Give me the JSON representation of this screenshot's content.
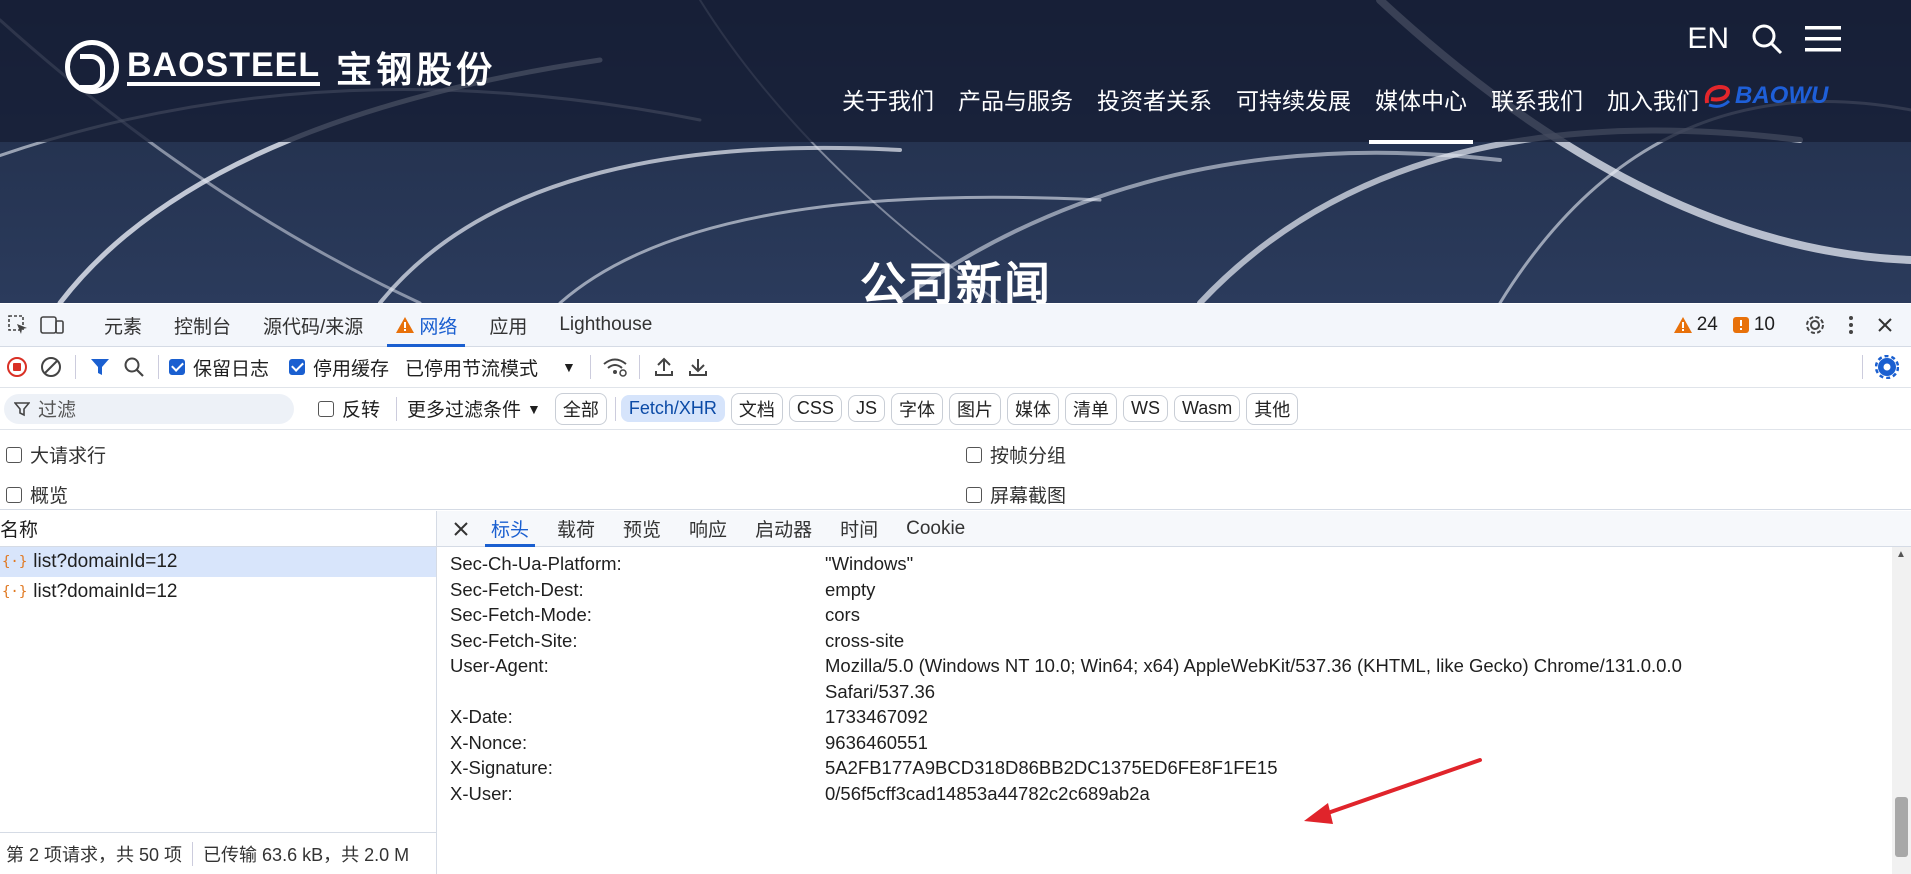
{
  "site": {
    "logo_en": "BAOSTEEL",
    "logo_cn": "宝钢股份",
    "lang": "EN",
    "nav": [
      "关于我们",
      "产品与服务",
      "投资者关系",
      "可持续发展",
      "媒体中心",
      "联系我们",
      "加入我们"
    ],
    "active_nav": "媒体中心",
    "partner_logo": "BAOWU",
    "banner_title": "公司新闻"
  },
  "devtools": {
    "tabs": [
      "元素",
      "控制台",
      "源代码/来源",
      "网络",
      "应用",
      "Lighthouse"
    ],
    "active_tab": "网络",
    "warnings": "24",
    "errors": "10",
    "toolbar": {
      "preserve_log": "保留日志",
      "disable_cache": "停用缓存",
      "throttle": "已停用节流模式"
    },
    "filter": {
      "placeholder": "过滤",
      "invert": "反转",
      "more_filters": "更多过滤条件",
      "chips": [
        "全部",
        "Fetch/XHR",
        "文档",
        "CSS",
        "JS",
        "字体",
        "图片",
        "媒体",
        "清单",
        "WS",
        "Wasm",
        "其他"
      ],
      "selected_chip": "Fetch/XHR"
    },
    "options": {
      "big_rows": "大请求行",
      "group_by_frame": "按帧分组",
      "overview": "概览",
      "screenshots": "屏幕截图"
    },
    "list_header": "名称",
    "requests": [
      "list?domainId=12",
      "list?domainId=12"
    ],
    "status": {
      "requests": "第 2 项请求，共 50 项",
      "transferred": "已传输 63.6 kB，共 2.0 M"
    },
    "detail_tabs": [
      "标头",
      "载荷",
      "预览",
      "响应",
      "启动器",
      "时间",
      "Cookie"
    ],
    "active_detail_tab": "标头",
    "headers": [
      {
        "key": "Sec-Ch-Ua-Platform:",
        "value": "\"Windows\""
      },
      {
        "key": "Sec-Fetch-Dest:",
        "value": "empty"
      },
      {
        "key": "Sec-Fetch-Mode:",
        "value": "cors"
      },
      {
        "key": "Sec-Fetch-Site:",
        "value": "cross-site"
      },
      {
        "key": "User-Agent:",
        "value": "Mozilla/5.0 (Windows NT 10.0; Win64; x64) AppleWebKit/537.36 (KHTML, like Gecko) Chrome/131.0.0.0 Safari/537.36"
      },
      {
        "key": "X-Date:",
        "value": "1733467092"
      },
      {
        "key": "X-Nonce:",
        "value": "9636460551"
      },
      {
        "key": "X-Signature:",
        "value": "5A2FB177A9BCD318D86BB2DC1375ED6FE8F1FE15"
      },
      {
        "key": "X-User:",
        "value": "0/56f5cff3cad14853a44782c2c689ab2a"
      }
    ],
    "accent": "#1a5fd0",
    "annotation_color": "#e0242b"
  }
}
